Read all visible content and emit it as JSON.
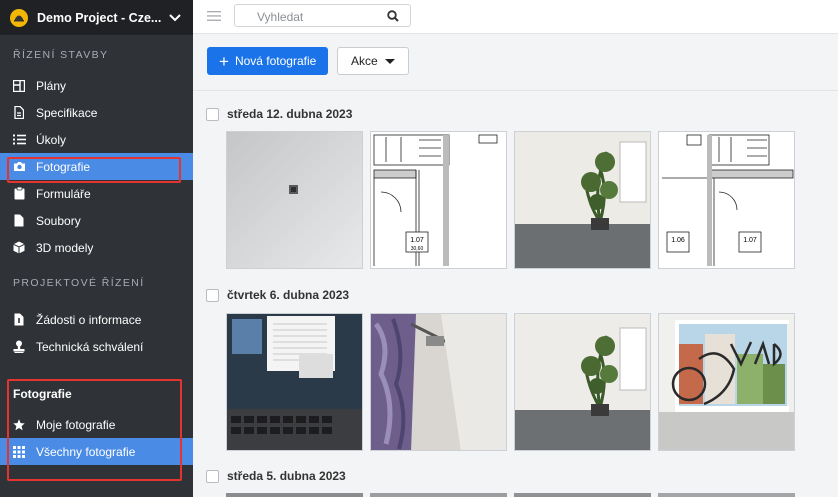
{
  "project": {
    "name": "Demo Project - Cze..."
  },
  "sidebar": {
    "section1": "ŘÍZENÍ STAVBY",
    "items1": [
      {
        "label": "Plány",
        "icon": "plans-icon"
      },
      {
        "label": "Specifikace",
        "icon": "specification-icon"
      },
      {
        "label": "Úkoly",
        "icon": "tasks-icon"
      },
      {
        "label": "Fotografie",
        "icon": "camera-icon",
        "active": true
      },
      {
        "label": "Formuláře",
        "icon": "forms-icon"
      },
      {
        "label": "Soubory",
        "icon": "files-icon"
      },
      {
        "label": "3D modely",
        "icon": "cube-icon"
      }
    ],
    "section2": "PROJEKTOVÉ ŘÍZENÍ",
    "items2": [
      {
        "label": "Žádosti o informace",
        "icon": "rfi-icon"
      },
      {
        "label": "Technická schválení",
        "icon": "approval-icon"
      }
    ],
    "photos_heading": "Fotografie",
    "items3": [
      {
        "label": "Moje fotografie",
        "icon": "star-icon"
      },
      {
        "label": "Všechny fotografie",
        "icon": "grid-icon",
        "active": true
      }
    ]
  },
  "search": {
    "placeholder": "Vyhledat"
  },
  "toolbar": {
    "new_photo": "Nová fotografie",
    "actions": "Akce"
  },
  "groups": [
    {
      "date": "středa 12. dubna 2023",
      "photos": [
        "wall",
        "plan",
        "plant",
        "plan"
      ]
    },
    {
      "date": "čtvrtek 6. dubna 2023",
      "photos": [
        "laptop",
        "curtain",
        "plant",
        "window"
      ]
    },
    {
      "date": "středa 5. dubna 2023",
      "photos": []
    }
  ],
  "plan_labels": {
    "room_a": "1.07",
    "room_b": "1.06",
    "area": "30,60"
  },
  "colors": {
    "sidebar": "#2f3237",
    "accent": "#4a8be6",
    "primary": "#1a73e8",
    "highlight": "#e3342f"
  }
}
